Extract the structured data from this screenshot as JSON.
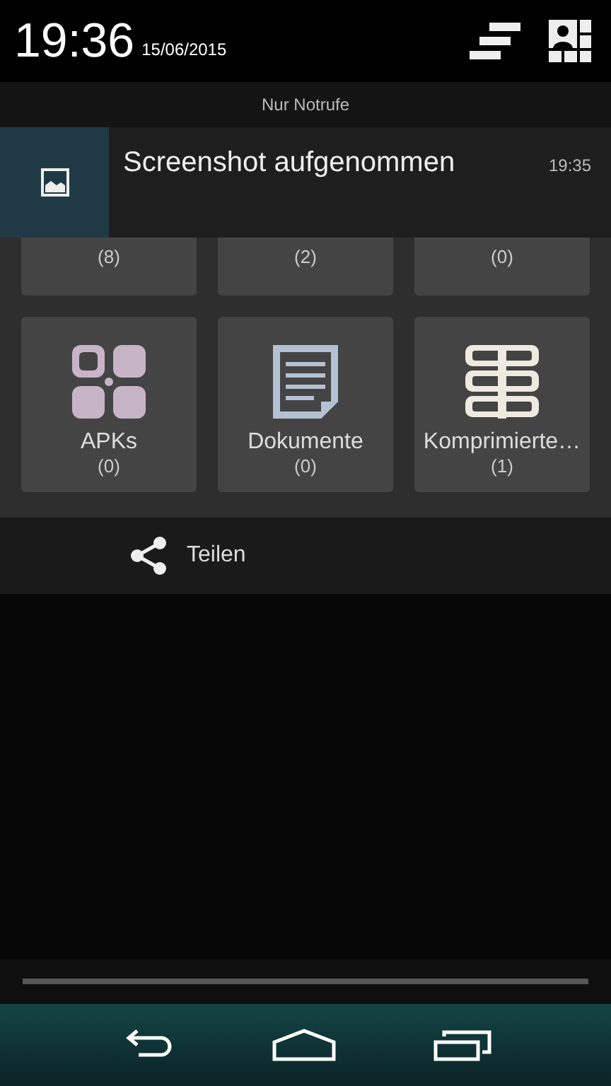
{
  "status_header": {
    "time": "19:36",
    "date": "15/06/2015"
  },
  "carrier_label": "Nur Notrufe",
  "notification": {
    "title": "Screenshot aufgenommen",
    "time": "19:35"
  },
  "tiles_top": [
    {
      "count": "(8)"
    },
    {
      "count": "(2)"
    },
    {
      "count": "(0)"
    }
  ],
  "tiles": [
    {
      "kind": "apk",
      "label": "APKs",
      "count": "(0)"
    },
    {
      "kind": "document",
      "label": "Dokumente",
      "count": "(0)"
    },
    {
      "kind": "archive",
      "label": "Komprimierte…",
      "count": "(1)"
    }
  ],
  "share_action": {
    "label": "Teilen"
  }
}
